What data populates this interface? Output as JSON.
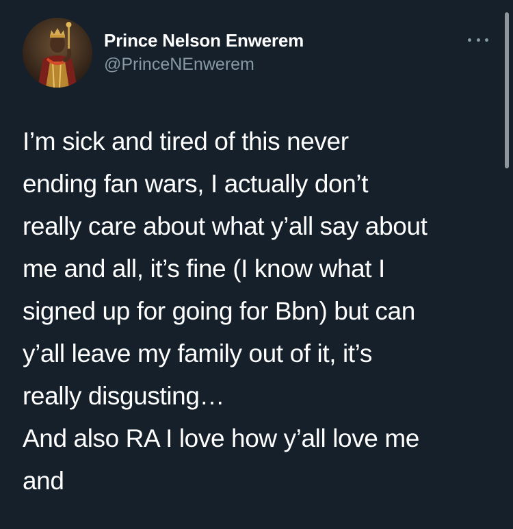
{
  "author": {
    "display_name": "Prince Nelson Enwerem",
    "handle": "@PrinceNEnwerem",
    "avatar": "avatar-photo"
  },
  "icons": {
    "more": "more-options-icon"
  },
  "tweet": {
    "lines": [
      "I’m sick and tired of this never",
      "ending fan wars, I actually don’t",
      "really care about what y’all say about",
      "me and all, it’s fine (I know what I",
      "signed up for going for Bbn) but can",
      "y’all leave my family out of it, it’s",
      "really disgusting…",
      "And also RA I love how y’all love me",
      "and"
    ]
  },
  "colors": {
    "background": "#15202b",
    "primary_text": "#ffffff",
    "secondary_text": "#8899a6"
  }
}
